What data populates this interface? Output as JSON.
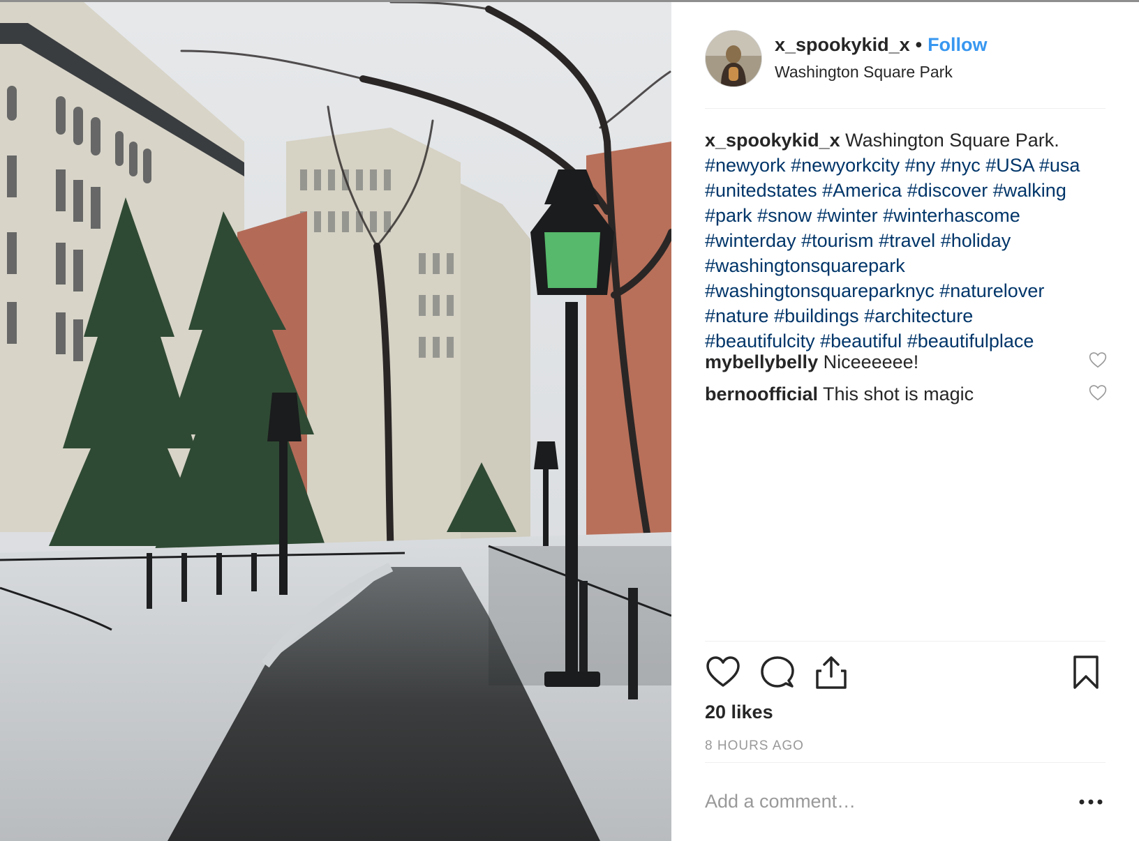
{
  "post": {
    "username": "x_spookykid_x",
    "separator": "•",
    "follow_label": "Follow",
    "location": "Washington Square Park",
    "caption_user": "x_spookykid_x",
    "caption_text": "Washington Square Park.",
    "hashtags": [
      "#newyork",
      "#newyorkcity",
      "#ny",
      "#nyc",
      "#USA",
      "#usa",
      "#unitedstates",
      "#America",
      "#discover",
      "#walking",
      "#park",
      "#snow",
      "#winter",
      "#winterhascome",
      "#winterday",
      "#tourism",
      "#travel",
      "#holiday",
      "#washingtonsquarepark",
      "#washingtonsquareparknyc",
      "#naturelover",
      "#nature",
      "#buildings",
      "#architecture",
      "#beautifulcity",
      "#beautiful",
      "#beautifulplace"
    ],
    "comments": [
      {
        "user": "mybellybelly",
        "text": "Niceeeeee!"
      },
      {
        "user": "bernoofficial",
        "text": "This shot is magic"
      }
    ],
    "likes": "20 likes",
    "time": "8 HOURS AGO",
    "comment_placeholder": "Add a comment…"
  },
  "icons": {
    "like": "heart-icon",
    "comment": "speech-bubble-icon",
    "share": "share-icon",
    "save": "bookmark-icon",
    "more": "ellipsis-icon",
    "comment_like": "heart-outline-icon"
  },
  "colors": {
    "follow": "#3897f0",
    "hashtag": "#003569",
    "muted": "#999999",
    "text": "#262626"
  }
}
